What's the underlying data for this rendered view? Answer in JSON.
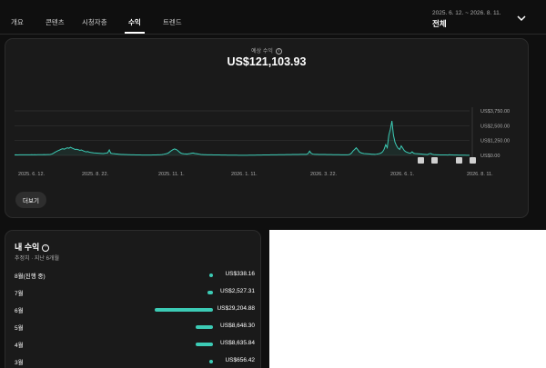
{
  "nav": {
    "tabs": [
      {
        "label": "개요"
      },
      {
        "label": "콘텐츠"
      },
      {
        "label": "시청자층"
      },
      {
        "label": "수익"
      },
      {
        "label": "트렌드"
      }
    ],
    "active_tab": "수익",
    "date_range": "2025. 6. 12. ~ 2026. 8. 11.",
    "date_value": "전체",
    "dropdown_icon": "chevron-down-icon"
  },
  "estimate": {
    "label": "예상 수익",
    "value": "US$121,103.93"
  },
  "chart_data": {
    "type": "line",
    "x_tick_labels": [
      "2025. 6. 12.",
      "2025. 8. 22.",
      "2025. 11. 1.",
      "2026. 1. 11.",
      "2026. 3. 22.",
      "2026. 6. 1.",
      "2026. 8. 11."
    ],
    "y_tick_labels": [
      "US$0.00",
      "US$1,250.00",
      "US$2,500.00",
      "US$3,750.00"
    ],
    "ylim": [
      0,
      3750
    ],
    "values": [
      40,
      45,
      42,
      50,
      45,
      48,
      44,
      50,
      46,
      52,
      48,
      55,
      50,
      58,
      52,
      60,
      55,
      62,
      58,
      65,
      62,
      70,
      68,
      80,
      110,
      180,
      260,
      330,
      400,
      450,
      520,
      560,
      520,
      590,
      640,
      600,
      680,
      620,
      560,
      500,
      520,
      480,
      420,
      460,
      400,
      340,
      300,
      320,
      280,
      250,
      230,
      210,
      200,
      190,
      180,
      170,
      160,
      150,
      170,
      190,
      220,
      460,
      180,
      150,
      140,
      120,
      110,
      100,
      90,
      80,
      75,
      70,
      65,
      60,
      55,
      50,
      48,
      45,
      43,
      40,
      38,
      35,
      33,
      30,
      28,
      26,
      25,
      27,
      30,
      34,
      38,
      42,
      46,
      52,
      58,
      70,
      90,
      120,
      150,
      200,
      300,
      400,
      480,
      540,
      500,
      420,
      300,
      200,
      150,
      130,
      120,
      110,
      130,
      150,
      180,
      200,
      160,
      140,
      120,
      100,
      80,
      70,
      60,
      55,
      50,
      48,
      46,
      44,
      42,
      40,
      38,
      36,
      34,
      32,
      30,
      28,
      26,
      24,
      22,
      20,
      18,
      17,
      16,
      15,
      14,
      13,
      12,
      11,
      10,
      12,
      14,
      16,
      18,
      20,
      22,
      24,
      26,
      28,
      30,
      32,
      34,
      36,
      38,
      40,
      42,
      44,
      46,
      48,
      50,
      52,
      54,
      56,
      58,
      60,
      62,
      64,
      66,
      68,
      70,
      72,
      74,
      76,
      78,
      80,
      82,
      84,
      86,
      88,
      90,
      150,
      360,
      180,
      110,
      95,
      90,
      85,
      80,
      78,
      76,
      74,
      72,
      70,
      68,
      66,
      64,
      62,
      60,
      58,
      56,
      54,
      52,
      50,
      48,
      46,
      44,
      60,
      90,
      200,
      380,
      500,
      640,
      480,
      300,
      220,
      180,
      150,
      140,
      130,
      120,
      110,
      100,
      95,
      90,
      100,
      120,
      150,
      200,
      300,
      520,
      900,
      650,
      1700,
      2200,
      2900,
      1700,
      1100,
      800,
      600,
      500,
      800,
      600,
      400,
      300,
      250,
      200,
      180,
      300,
      180,
      150,
      140,
      130,
      120,
      110,
      100,
      90,
      80,
      70,
      140,
      160,
      90,
      70,
      60,
      50,
      45,
      42,
      40,
      38,
      36,
      34,
      32,
      60,
      40,
      35,
      30,
      28,
      26,
      24,
      22,
      20,
      18,
      16,
      14,
      12,
      10
    ],
    "grid": true
  },
  "chart_markers": [
    "ch-marker-icon",
    "ch-marker-icon",
    "ch-marker-icon",
    "ch-marker-icon"
  ],
  "more_button": "더보기",
  "earnings": {
    "title": "내 수익",
    "subtitle": "추정치 · 지난 6개월",
    "accent": "#3ccbb5",
    "rows": [
      {
        "month": "8월(진행 중)",
        "amount": "US$338.16",
        "value": 338.16
      },
      {
        "month": "7월",
        "amount": "US$2,527.31",
        "value": 2527.31
      },
      {
        "month": "6월",
        "amount": "US$29,204.88",
        "value": 29204.88
      },
      {
        "month": "5월",
        "amount": "US$8,648.30",
        "value": 8648.3
      },
      {
        "month": "4월",
        "amount": "US$8,635.84",
        "value": 8635.84
      },
      {
        "month": "3월",
        "amount": "US$656.42",
        "value": 656.42
      }
    ]
  }
}
